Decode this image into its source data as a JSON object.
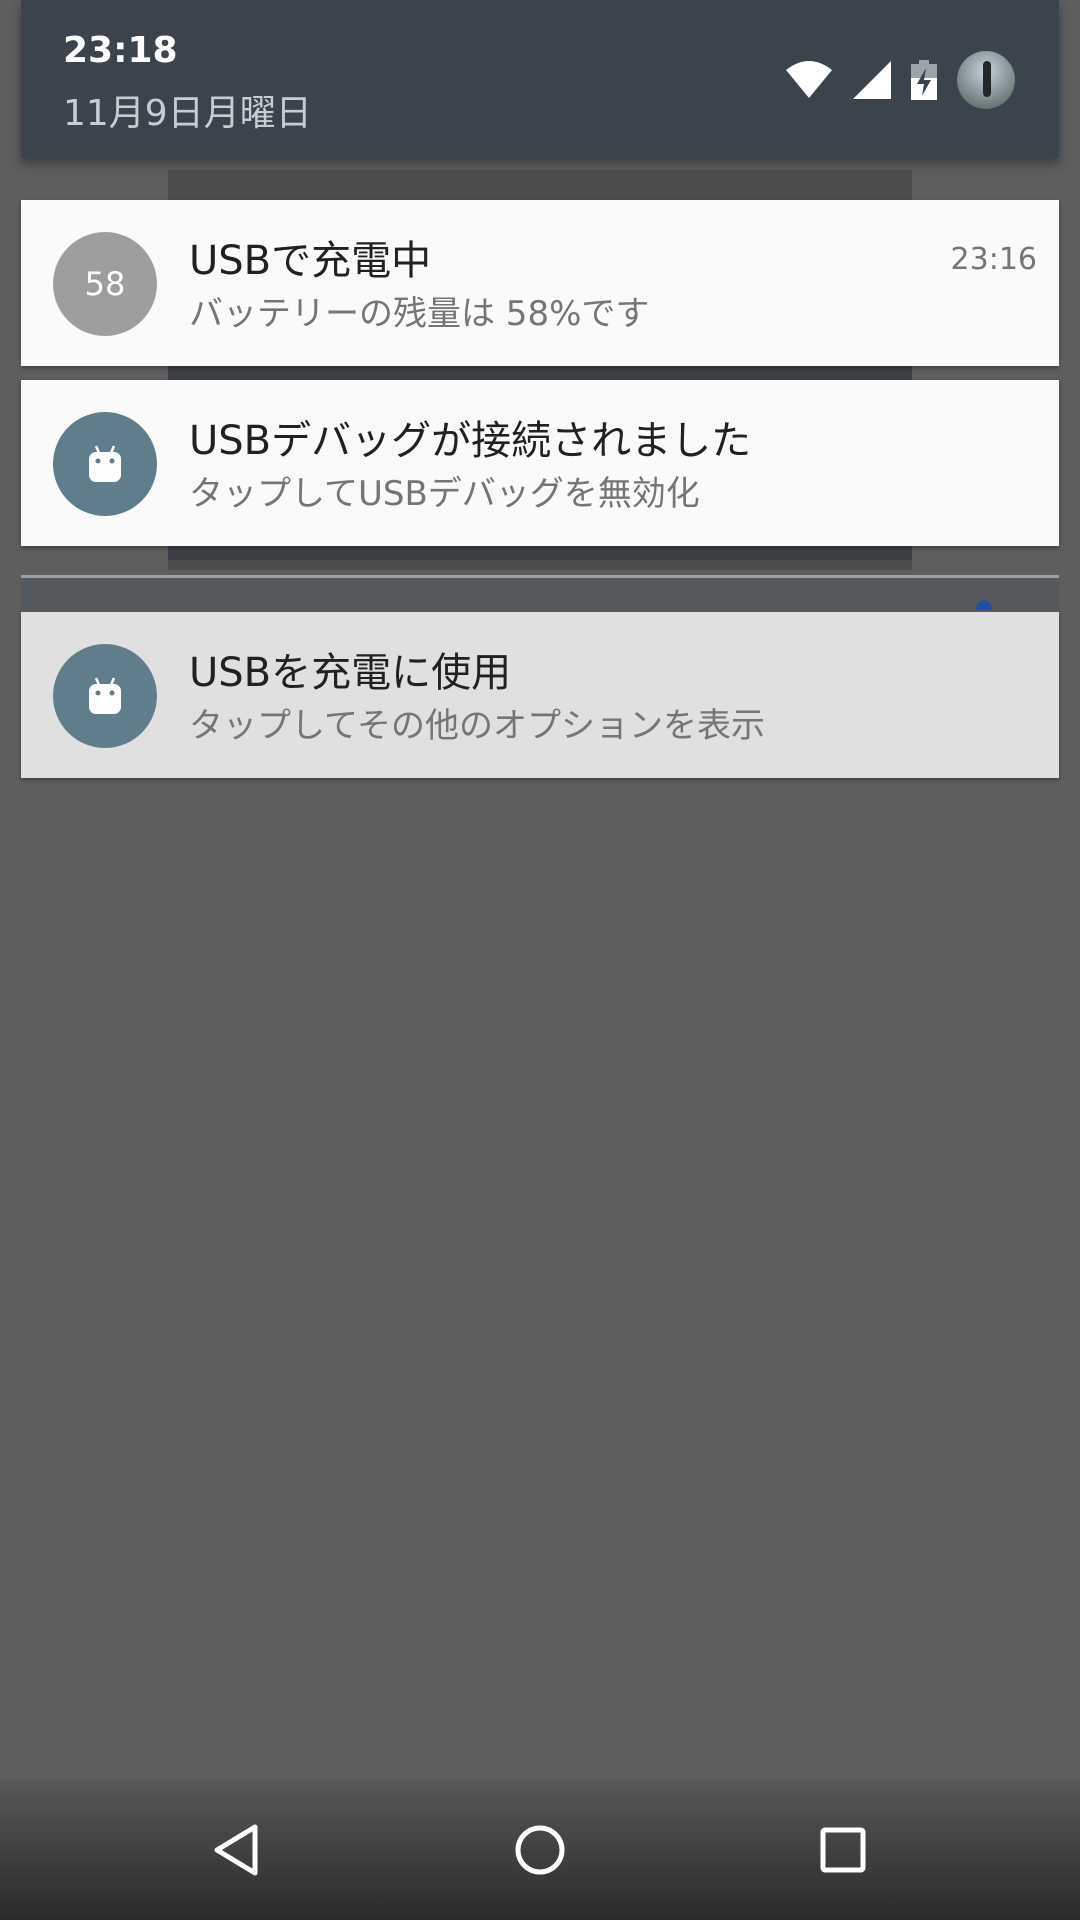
{
  "header": {
    "time": "23:18",
    "date": "11月9日月曜日",
    "status_icons": [
      "wifi-icon",
      "cell-signal-icon",
      "battery-charging-icon",
      "user-avatar"
    ]
  },
  "notifications": [
    {
      "icon_text": "58",
      "icon_color": "#9e9e9e",
      "title": "USBで充電中",
      "text": "バッテリーの残量は 58%です",
      "time": "23:16"
    },
    {
      "icon": "android-icon",
      "icon_color": "#607d8b",
      "title": "USBデバッグが接続されました",
      "text": "タップしてUSBデバッグを無効化"
    },
    {
      "icon": "android-icon",
      "icon_color": "#607d8b",
      "title": "USBを充電に使用",
      "text": "タップしてその他のオプションを表示"
    }
  ],
  "navbar": {
    "buttons": [
      "back-icon",
      "home-icon",
      "recents-icon"
    ]
  },
  "colors": {
    "header_bg": "#3b444d",
    "card_bg": "#fafafa",
    "scrim": "#5e5e5e"
  }
}
